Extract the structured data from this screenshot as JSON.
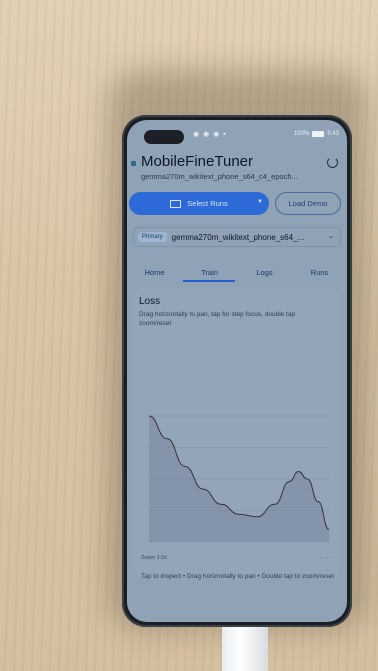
{
  "status": {
    "battery": "100%",
    "time": "5:43"
  },
  "app": {
    "title": "MobileFineTuner",
    "subtitle": "gemma270m_wikitext_phone_s64_c4_epoch..."
  },
  "actions": {
    "select_runs": "Select Runs",
    "load_demo": "Load Demo"
  },
  "run": {
    "badge": "Primary",
    "name": "gemma270m_wikitext_phone_s64_..."
  },
  "tabs": [
    "Home",
    "Train",
    "Logs",
    "Runs"
  ],
  "card": {
    "title": "Loss",
    "hint": "Drag horizontally to pan, tap for step focus, double tap zoom/reset"
  },
  "footer": {
    "zoom": "Zoom 1.0x",
    "hint": "Tap to inspect • Drag horizontally to pan • Double tap to zoom/reset"
  },
  "colors": {
    "accent": "#2d6ad8",
    "screen": "#8fa2b6",
    "line": "#3a2e3a"
  },
  "chart_data": {
    "type": "line",
    "title": "Loss",
    "series": [
      {
        "values": [
          [
            0,
            1.0
          ],
          [
            0.1,
            0.82
          ],
          [
            0.2,
            0.6
          ],
          [
            0.3,
            0.42
          ],
          [
            0.4,
            0.3
          ],
          [
            0.5,
            0.22
          ],
          [
            0.6,
            0.2
          ],
          [
            0.7,
            0.3
          ],
          [
            0.78,
            0.48
          ],
          [
            0.83,
            0.56
          ],
          [
            0.88,
            0.5
          ],
          [
            0.94,
            0.32
          ],
          [
            1.0,
            0.1
          ]
        ]
      }
    ]
  }
}
